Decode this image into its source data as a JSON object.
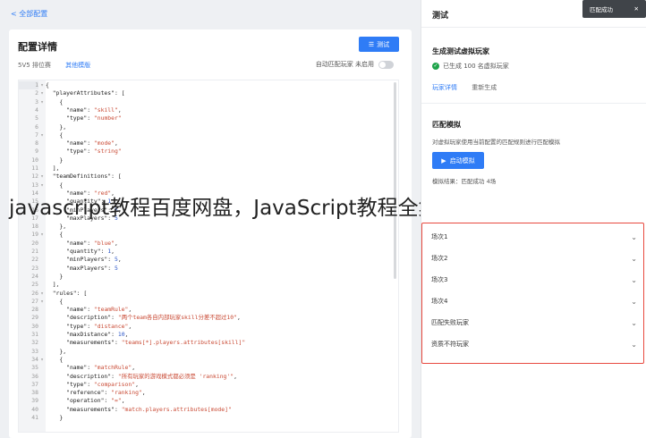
{
  "topbar": {
    "back_label": "< 全部配置"
  },
  "config": {
    "title": "配置详情",
    "test_button": "测试",
    "mode_label": "5V5 排位赛",
    "other_mode": "其他模版",
    "auto_match_label": "自动匹配玩家 未启用"
  },
  "editor": {
    "lines": [
      {
        "n": "1",
        "f": "▾",
        "t": "{"
      },
      {
        "n": "2",
        "f": "▾",
        "t": "  \"playerAttributes\": ["
      },
      {
        "n": "3",
        "f": "▾",
        "t": "    {"
      },
      {
        "n": "4",
        "f": "",
        "t": "      \"name\": \"skill\","
      },
      {
        "n": "5",
        "f": "",
        "t": "      \"type\": \"number\""
      },
      {
        "n": "6",
        "f": "",
        "t": "    },"
      },
      {
        "n": "7",
        "f": "▾",
        "t": "    {"
      },
      {
        "n": "8",
        "f": "",
        "t": "      \"name\": \"mode\","
      },
      {
        "n": "9",
        "f": "",
        "t": "      \"type\": \"string\""
      },
      {
        "n": "10",
        "f": "",
        "t": "    }"
      },
      {
        "n": "11",
        "f": "",
        "t": "  ],"
      },
      {
        "n": "12",
        "f": "▾",
        "t": "  \"teamDefinitions\": ["
      },
      {
        "n": "13",
        "f": "▾",
        "t": "    {"
      },
      {
        "n": "14",
        "f": "",
        "t": "      \"name\": \"red\","
      },
      {
        "n": "15",
        "f": "",
        "t": "      \"quantity\": 1,"
      },
      {
        "n": "16",
        "f": "",
        "t": "      \"minPlayers\": 5,"
      },
      {
        "n": "17",
        "f": "",
        "t": "      \"maxPlayers\": 5"
      },
      {
        "n": "18",
        "f": "",
        "t": "    },"
      },
      {
        "n": "19",
        "f": "▾",
        "t": "    {"
      },
      {
        "n": "20",
        "f": "",
        "t": "      \"name\": \"blue\","
      },
      {
        "n": "21",
        "f": "",
        "t": "      \"quantity\": 1,"
      },
      {
        "n": "22",
        "f": "",
        "t": "      \"minPlayers\": 5,"
      },
      {
        "n": "23",
        "f": "",
        "t": "      \"maxPlayers\": 5"
      },
      {
        "n": "24",
        "f": "",
        "t": "    }"
      },
      {
        "n": "25",
        "f": "",
        "t": "  ],"
      },
      {
        "n": "26",
        "f": "▾",
        "t": "  \"rules\": ["
      },
      {
        "n": "27",
        "f": "▾",
        "t": "    {"
      },
      {
        "n": "28",
        "f": "",
        "t": "      \"name\": \"teamRule\","
      },
      {
        "n": "29",
        "f": "",
        "t": "      \"description\": \"两个team各自内部玩家skill分差不超过10\","
      },
      {
        "n": "30",
        "f": "",
        "t": "      \"type\": \"distance\","
      },
      {
        "n": "31",
        "f": "",
        "t": "      \"maxDistance\": 10,"
      },
      {
        "n": "32",
        "f": "",
        "t": "      \"measurements\": \"teams[*].players.attributes[skill]\""
      },
      {
        "n": "33",
        "f": "",
        "t": "    },"
      },
      {
        "n": "34",
        "f": "▾",
        "t": "    {"
      },
      {
        "n": "35",
        "f": "",
        "t": "      \"name\": \"matchRule\","
      },
      {
        "n": "36",
        "f": "",
        "t": "      \"description\": \"所有玩家的游戏模式都必须是 'ranking'\","
      },
      {
        "n": "37",
        "f": "",
        "t": "      \"type\": \"comparison\","
      },
      {
        "n": "38",
        "f": "",
        "t": "      \"reference\": \"ranking\","
      },
      {
        "n": "39",
        "f": "",
        "t": "      \"operation\": \"=\","
      },
      {
        "n": "40",
        "f": "",
        "t": "      \"measurements\": \"match.players.attributes[mode]\""
      },
      {
        "n": "41",
        "f": "",
        "t": "    }"
      }
    ]
  },
  "overlay": {
    "text": "javascript教程百度网盘，JavaScript教程全集，百度网盘免费下载"
  },
  "panel": {
    "title": "测试",
    "toast": "匹配成功",
    "gen_title": "生成测试虚拟玩家",
    "gen_status": "已生成 100 名虚拟玩家",
    "player_detail": "玩家详情",
    "regenerate": "重新生成",
    "sim_title": "匹配模拟",
    "sim_desc": "对虚拟玩家使用当前配置的匹配规则进行匹配模拟",
    "start_button": "启动模拟",
    "sim_result": "模拟结果：匹配成功 4场",
    "rounds": [
      "场次1",
      "场次2",
      "场次3",
      "场次4",
      "匹配失败玩家",
      "资质不符玩家"
    ]
  },
  "colors": {
    "accent": "#2f7cf6",
    "success": "#1ea44a",
    "highlight": "#e8493f"
  }
}
